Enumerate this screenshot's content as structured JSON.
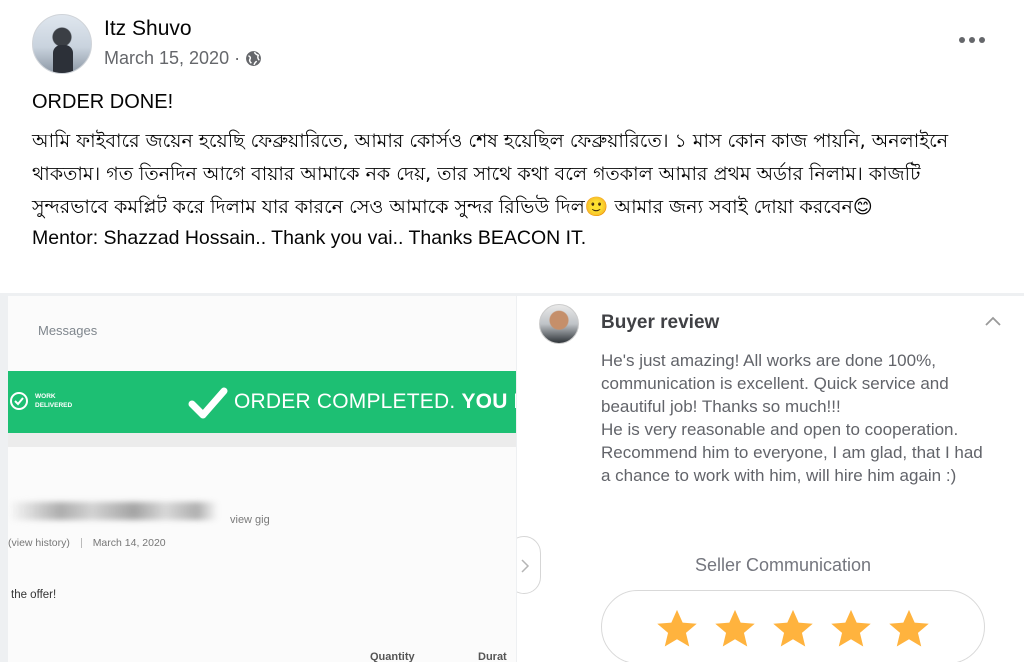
{
  "post": {
    "author": "Itz Shuvo",
    "date": "March 15, 2020",
    "date_separator": "·",
    "privacy_icon": "globe-icon",
    "menu_icon": "more-options-icon",
    "title": "ORDER DONE!",
    "body_bengali": "আমি ফাইবারে জয়েন হয়েছি ফেব্রুয়ারিতে, আমার কোর্সও শেষ হয়েছিল ফেব্রুয়ারিতে। ১ মাস কোন কাজ পায়নি, অনলাইনে থাকতাম। গত তিনদিন আগে বায়ার আমাকে নক দেয়, তার সাথে কথা বলে গতকাল আমার প্রথম অর্ডার নিলাম। কাজটি সুন্দরভাবে কমপ্লিট করে দিলাম যার কারনে সেও আমাকে সুন্দর রিভিউ দিল🙂 আমার জন্য সবাই দোয়া করবেন😊",
    "mentor_line": "Mentor: Shazzad Hossain.. Thank you vai.. Thanks BEACON IT."
  },
  "left_screenshot": {
    "messages_label": "Messages",
    "work_delivered_line1": "WORK",
    "work_delivered_line2": "DELIVERED",
    "order_completed": "ORDER COMPLETED.",
    "order_completed_suffix": "YOU EA",
    "view_gig": "view gig",
    "view_history": "(view history)",
    "history_date": "March 14, 2020",
    "offer_text": "the offer!",
    "col_quantity": "Quantity",
    "col_duration": "Durat",
    "accent_color": "#1dbf73"
  },
  "review": {
    "heading": "Buyer review",
    "text": "He's just amazing! All works are done 100%, communication is excellent. Quick service and beautiful job! Thanks so much!!!\nHe is very reasonable and open to cooperation. Recommend him to everyone, I am glad, that I had a chance to work with him, will hire him again :)",
    "rating_label": "Seller Communication",
    "rating_value": 5,
    "rating_max": 5,
    "star_color": "#ffb33e"
  }
}
